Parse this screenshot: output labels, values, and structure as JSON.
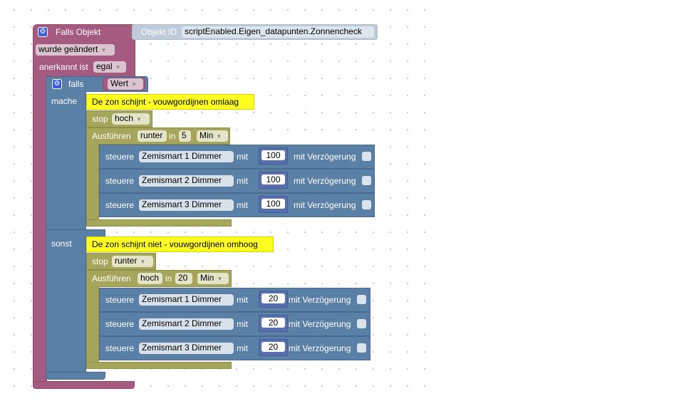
{
  "trigger": {
    "title": "Falls Objekt",
    "objekt_id_label": "Objekt ID",
    "objekt_id_value": "scriptEnabled.Eigen_datapunten.Zonnencheck",
    "changed_value": "wurde geändert",
    "ack_label": "anerkannt ist",
    "ack_value": "egal"
  },
  "if_block": {
    "if_label": "falls",
    "condition": "Wert",
    "then_label": "mache",
    "else_label": "sonst"
  },
  "then": {
    "comment": "De zon schijnt - vouwgordijnen omlaag",
    "stop_label": "stop",
    "stop_value": "hoch",
    "exec_label": "Ausführen",
    "exec_value": "runter",
    "in_label": "in",
    "delay_value": "5",
    "unit_value": "Min",
    "controls": [
      {
        "label": "steuere",
        "device": "Zemismart 1  Dimmer",
        "mit": "mit",
        "value": "100",
        "delay_label": "mit Verzögerung"
      },
      {
        "label": "steuere",
        "device": "Zemismart 2  Dimmer",
        "mit": "mit",
        "value": "100",
        "delay_label": "mit Verzögerung"
      },
      {
        "label": "steuere",
        "device": "Zemismart 3  Dimmer",
        "mit": "mit",
        "value": "100",
        "delay_label": "mit Verzögerung"
      }
    ]
  },
  "else": {
    "comment": "De zon schijnt niet - vouwgordijnen omhoog",
    "stop_label": "stop",
    "stop_value": "runter",
    "exec_label": "Ausführen",
    "exec_value": "hoch",
    "in_label": "in",
    "delay_value": "20",
    "unit_value": "Min",
    "controls": [
      {
        "label": "steuere",
        "device": "Zemismart 1  Dimmer",
        "mit": "mit",
        "value": "20",
        "delay_label": "mit Verzögerung"
      },
      {
        "label": "steuere",
        "device": "Zemismart 2  Dimmer",
        "mit": "mit",
        "value": "20",
        "delay_label": "mit Verzögerung"
      },
      {
        "label": "steuere",
        "device": "Zemismart 3  Dimmer",
        "mit": "mit",
        "value": "20",
        "delay_label": "mit Verzögerung"
      }
    ]
  },
  "icons": {
    "gear": "gear-icon",
    "dropdown": "triangle-down-icon"
  },
  "colors": {
    "trigger": "#a55b80",
    "logic": "#5b80a5",
    "timer": "#a5a55b",
    "comment": "#ffff22",
    "number": "#586fae"
  }
}
